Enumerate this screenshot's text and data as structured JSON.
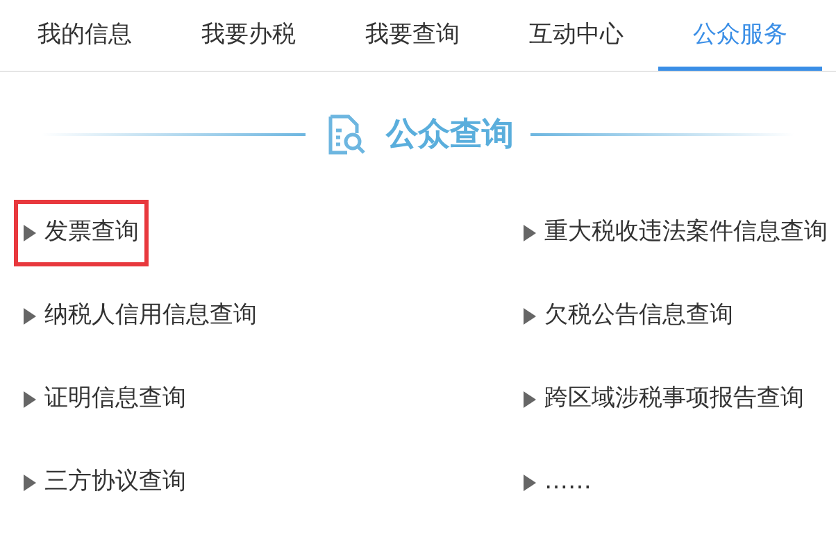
{
  "tabs": [
    {
      "label": "我的信息",
      "selected": false
    },
    {
      "label": "我要办税",
      "selected": false
    },
    {
      "label": "我要查询",
      "selected": false
    },
    {
      "label": "互动中心",
      "selected": false
    },
    {
      "label": "公众服务",
      "selected": true
    }
  ],
  "section": {
    "title": "公众查询"
  },
  "links": [
    {
      "label": "发票查询",
      "highlighted": true
    },
    {
      "label": "重大税收违法案件信息查询",
      "highlighted": false
    },
    {
      "label": "纳税人信用信息查询",
      "highlighted": false
    },
    {
      "label": "欠税公告信息查询",
      "highlighted": false
    },
    {
      "label": "证明信息查询",
      "highlighted": false
    },
    {
      "label": "跨区域涉税事项报告查询",
      "highlighted": false
    },
    {
      "label": "三方协议查询",
      "highlighted": false
    },
    {
      "label": "……",
      "highlighted": false
    }
  ]
}
